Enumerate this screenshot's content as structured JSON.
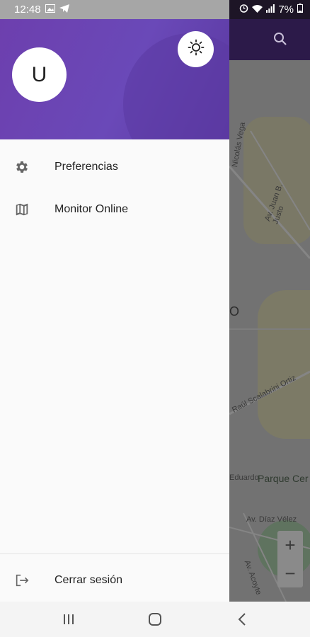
{
  "status_bar": {
    "time": "12:48",
    "battery": "7%"
  },
  "drawer": {
    "avatar_letter": "U",
    "items": [
      {
        "label": "Preferencias",
        "icon": "gear-icon"
      },
      {
        "label": "Monitor Online",
        "icon": "map-icon"
      }
    ],
    "logout_label": "Cerrar sesión"
  },
  "map": {
    "labels": [
      "Nicolás Vega",
      "Av. Juan B. Justo",
      "Raúl Scalabrini Ortiz",
      "Av. Díaz Vélez",
      "Av. Acoyte",
      "Eduardo"
    ],
    "big_label": "O",
    "park_label": "Parque Cer",
    "zoom_in": "+",
    "zoom_out": "−"
  },
  "colors": {
    "header": "#6b42b0",
    "toolbar": "#2c1a49"
  }
}
